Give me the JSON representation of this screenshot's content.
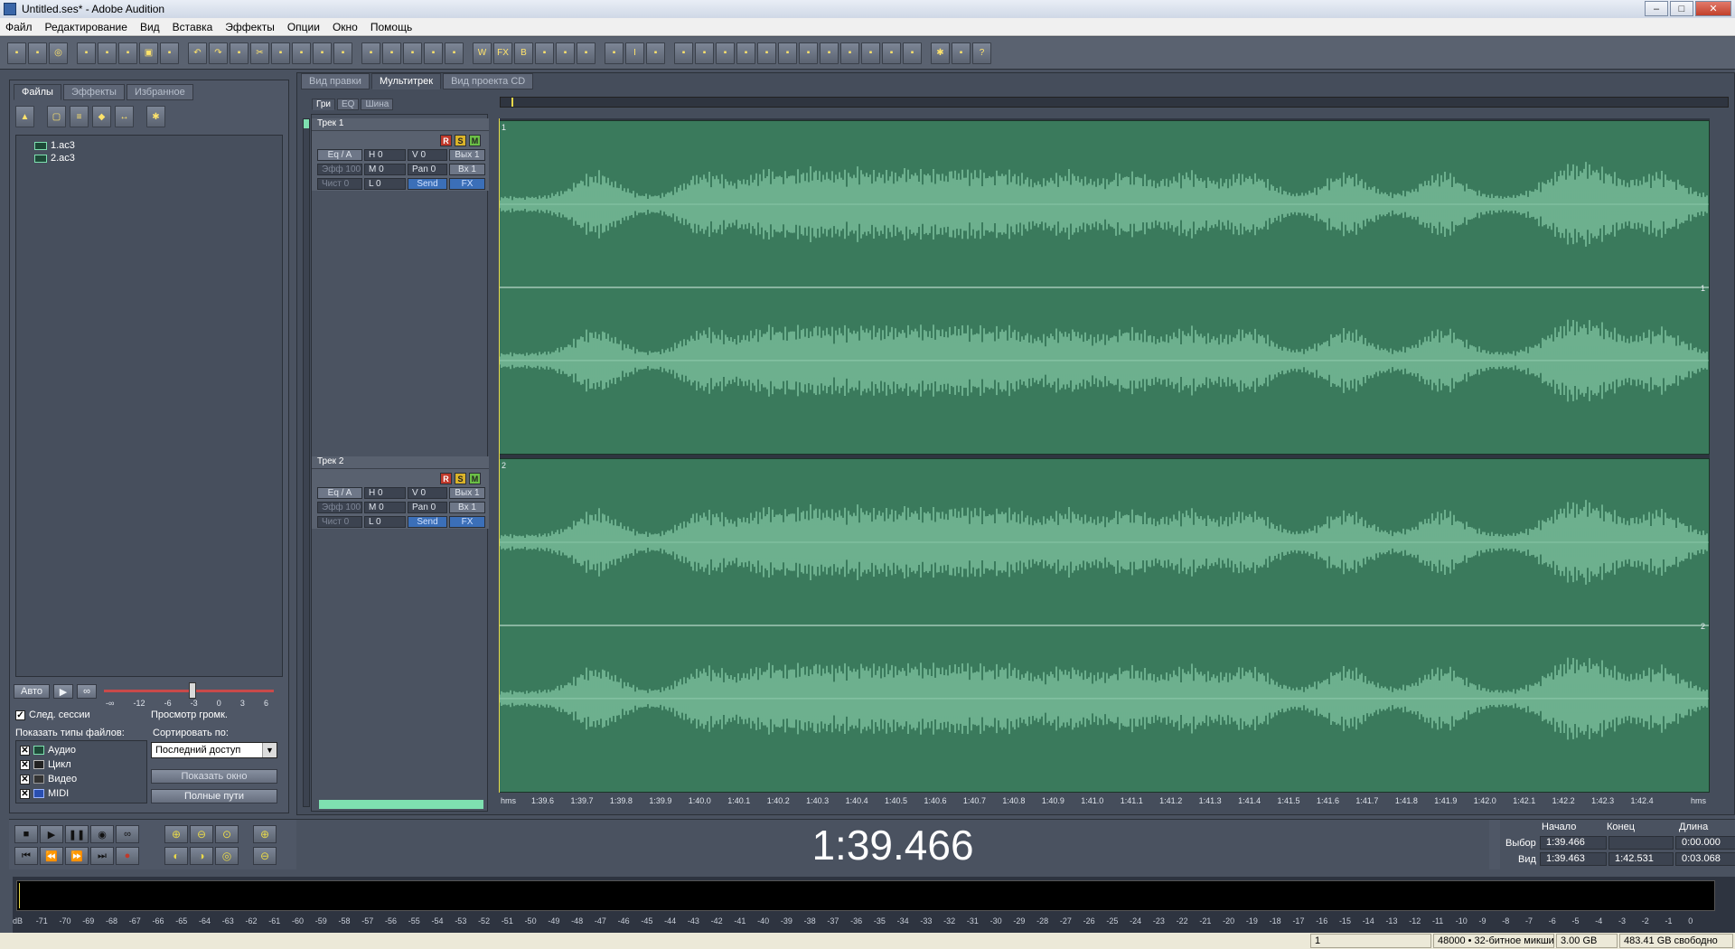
{
  "window": {
    "title": "Untitled.ses* - Adobe Audition"
  },
  "menu": [
    "Файл",
    "Редактирование",
    "Вид",
    "Вставка",
    "Эффекты",
    "Опции",
    "Окно",
    "Помощь"
  ],
  "left_panel": {
    "tabs": [
      "Файлы",
      "Эффекты",
      "Избранное"
    ],
    "files": [
      "1.ac3",
      "2.ac3"
    ],
    "auto_button": "Авто",
    "next_session_label": "След. сессии",
    "preview_volume_label": "Просмотр громк.",
    "slider_ticks": [
      "-∞",
      "-12",
      "-6",
      "-3",
      "0",
      "3",
      "6"
    ],
    "show_types_label": "Показать типы файлов:",
    "file_types": [
      "Аудио",
      "Цикл",
      "Видео",
      "MIDI"
    ],
    "sort_label": "Сортировать по:",
    "sort_value": "Последний доступ",
    "show_window_button": "Показать окно",
    "full_paths_button": "Полные пути"
  },
  "view_tabs": [
    "Вид правки",
    "Мультитрек",
    "Вид проекта CD"
  ],
  "mixer_tabs": [
    "Гри",
    "EQ",
    "Шина"
  ],
  "tracks": [
    {
      "name": "Трек 1",
      "eq": "Eq / A",
      "h": "H  0",
      "v": "V 0",
      "out": "Вых 1",
      "eff": "Эфф 100",
      "m": "M  0",
      "pan": "Pan 0",
      "in": "Вх 1",
      "clean": "Чист 0",
      "l": "L  0",
      "send": "Send",
      "fx": "FX",
      "index": "1"
    },
    {
      "name": "Трек 2",
      "eq": "Eq / A",
      "h": "H  0",
      "v": "V 0",
      "out": "Вых 1",
      "eff": "Эфф 100",
      "m": "M  0",
      "pan": "Pan 0",
      "in": "Вх 1",
      "clean": "Чист 0",
      "l": "L  0",
      "send": "Send",
      "fx": "FX",
      "index": "2"
    }
  ],
  "rsm": [
    "R",
    "S",
    "M"
  ],
  "ruler": {
    "unit": "hms",
    "ticks": [
      "1:39.6",
      "1:39.7",
      "1:39.8",
      "1:39.9",
      "1:40.0",
      "1:40.1",
      "1:40.2",
      "1:40.3",
      "1:40.4",
      "1:40.5",
      "1:40.6",
      "1:40.7",
      "1:40.8",
      "1:40.9",
      "1:41.0",
      "1:41.1",
      "1:41.2",
      "1:41.3",
      "1:41.4",
      "1:41.5",
      "1:41.6",
      "1:41.7",
      "1:41.8",
      "1:41.9",
      "1:42.0",
      "1:42.1",
      "1:42.2",
      "1:42.3",
      "1:42.4"
    ]
  },
  "time_display": "1:39.466",
  "selection": {
    "headers": [
      "Начало",
      "Конец",
      "Длина"
    ],
    "sel_label": "Выбор",
    "view_label": "Вид",
    "sel_start": "1:39.466",
    "sel_end": "",
    "sel_length": "0:00.000",
    "view_start": "1:39.463",
    "view_end": "1:42.531",
    "view_length": "0:03.068"
  },
  "meter_labels": [
    "dB",
    "-71",
    "-70",
    "-69",
    "-68",
    "-67",
    "-66",
    "-65",
    "-64",
    "-63",
    "-62",
    "-61",
    "-60",
    "-59",
    "-58",
    "-57",
    "-56",
    "-55",
    "-54",
    "-53",
    "-52",
    "-51",
    "-50",
    "-49",
    "-48",
    "-47",
    "-46",
    "-45",
    "-44",
    "-43",
    "-42",
    "-41",
    "-40",
    "-39",
    "-38",
    "-37",
    "-36",
    "-35",
    "-34",
    "-33",
    "-32",
    "-31",
    "-30",
    "-29",
    "-28",
    "-27",
    "-26",
    "-25",
    "-24",
    "-23",
    "-22",
    "-21",
    "-20",
    "-19",
    "-18",
    "-17",
    "-16",
    "-15",
    "-14",
    "-13",
    "-12",
    "-11",
    "-10",
    "-9",
    "-8",
    "-7",
    "-6",
    "-5",
    "-4",
    "-3",
    "-2",
    "-1",
    "0"
  ],
  "status": {
    "field1": "1",
    "format": "48000 • 32-битное микши",
    "size": "3.00 GB",
    "free": "483.41 GB свободно"
  },
  "colors": {
    "wave_bg": "#3a7a5c",
    "wave_fg": "#8fd4b0",
    "panel": "#4f5766"
  }
}
